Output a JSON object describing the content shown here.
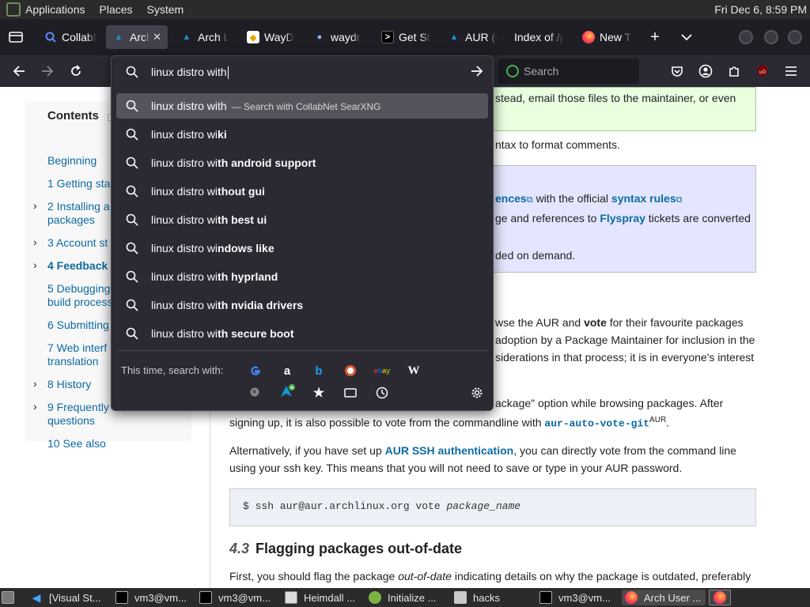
{
  "top_panel": {
    "menus": [
      "Applications",
      "Places",
      "System"
    ],
    "clock": "Fri Dec  6,  8:59 PM"
  },
  "tabs": [
    {
      "label": "CollabNet",
      "icon": "collabnet-icon",
      "active": false
    },
    {
      "label": "Arch User",
      "icon": "arch-icon",
      "active": true
    },
    {
      "label": "Arch Linux",
      "icon": "arch-icon",
      "active": false
    },
    {
      "label": "WayDroid",
      "icon": "waydroid-icon",
      "active": false
    },
    {
      "label": "waydroid",
      "icon": "waydroid-dot-icon",
      "active": false
    },
    {
      "label": "Get Started",
      "icon": "terminal-icon",
      "active": false
    },
    {
      "label": "AUR (en)",
      "icon": "arch-icon",
      "active": false
    },
    {
      "label": "Index of /p",
      "icon": "none",
      "active": false
    },
    {
      "label": "New Tab",
      "icon": "firefox-icon",
      "active": false
    }
  ],
  "search_bar": {
    "placeholder": "Search"
  },
  "urlbar": {
    "value": "linux distro with",
    "suggestions": [
      {
        "typed": "linux distro with",
        "rest": "",
        "sub": "— Search with CollabNet SearXNG",
        "highlight": true
      },
      {
        "typed": "linux distro wi",
        "rest": "ki",
        "sub": "",
        "highlight": false
      },
      {
        "typed": "linux distro wi",
        "rest": "th android support",
        "sub": "",
        "highlight": false
      },
      {
        "typed": "linux distro wi",
        "rest": "thout gui",
        "sub": "",
        "highlight": false
      },
      {
        "typed": "linux distro wi",
        "rest": "th best ui",
        "sub": "",
        "highlight": false
      },
      {
        "typed": "linux distro wi",
        "rest": "ndows like",
        "sub": "",
        "highlight": false
      },
      {
        "typed": "linux distro wi",
        "rest": "th hyprland",
        "sub": "",
        "highlight": false
      },
      {
        "typed": "linux distro wi",
        "rest": "th nvidia drivers",
        "sub": "",
        "highlight": false
      },
      {
        "typed": "linux distro wi",
        "rest": "th secure boot",
        "sub": "",
        "highlight": false
      }
    ],
    "engines_label": "This time, search with:",
    "engines": [
      "google-icon",
      "amazon-icon",
      "bing-icon",
      "duckduckgo-icon",
      "ebay-icon",
      "wikipedia-icon"
    ],
    "engines_row2": [
      "searxng-icon",
      "arch-add-icon",
      "bookmarks-star-icon",
      "tabs-icon",
      "history-icon"
    ]
  },
  "toc": {
    "title": "Contents",
    "items": [
      {
        "text": "Beginning",
        "chev": false,
        "bold": false
      },
      {
        "text": "1  Getting sta",
        "chev": false,
        "bold": false
      },
      {
        "text": "2  Installing a",
        "text2": "packages",
        "chev": true,
        "bold": false
      },
      {
        "text": "3  Account st",
        "chev": true,
        "bold": false
      },
      {
        "text": "4  Feedback",
        "chev": true,
        "bold": true
      },
      {
        "text": "5  Debugging",
        "text2": "build process",
        "chev": false,
        "bold": false
      },
      {
        "text": "6  Submitting",
        "chev": false,
        "bold": false
      },
      {
        "text": "7  Web interf",
        "text2": "translation",
        "chev": false,
        "bold": false
      },
      {
        "text": "8  History",
        "chev": true,
        "bold": false
      },
      {
        "text": "9  Frequently",
        "text2": "questions",
        "chev": true,
        "bold": false
      },
      {
        "text": "10  See also",
        "chev": false,
        "bold": false
      }
    ]
  },
  "content": {
    "green_line": "stead, email those files to the maintainer, or even",
    "syntax_line": "ntax to format comments.",
    "blue_l1_a": "ences",
    "blue_l1_b": " with the official ",
    "blue_l1_c": "syntax rules",
    "blue_l2_a": "ge and references to ",
    "blue_l2_b": "Flyspray",
    "blue_l2_c": " tickets are converted",
    "blue_l3": "ded on demand.",
    "vote_l1_a": "wse the AUR and ",
    "vote_l1_b": "vote",
    "vote_l1_c": " for their favourite packages",
    "vote_l2": " adoption by a Package Maintainer for inclusion in the",
    "vote_l3": "siderations in that process; it is in everyone's interest",
    "pkg_l1": "ackage\" option while browsing packages. After",
    "pkg_l2_a": "signing up, it is also possible to vote from the commandline with ",
    "pkg_l2_b": "aur-auto-vote-git",
    "pkg_l2_c": "AUR",
    "alt_l1_a": "Alternatively, if you have set up ",
    "alt_l1_b": "AUR SSH authentication",
    "alt_l1_c": ", you can directly vote from the command line",
    "alt_l2": "using your ssh key. This means that you will not need to save or type in your AUR password.",
    "code_a": "$ ssh aur@aur.archlinux.org vote ",
    "code_b": "package_name",
    "h3_num": "4.3",
    "h3_text": "Flagging packages out-of-date",
    "last_a": "First, you should flag the package ",
    "last_b": "out-of-date",
    "last_c": " indicating details on why the package is outdated, preferably"
  },
  "taskbar": [
    {
      "label": "[Visual St...",
      "icon": "vscode-icon",
      "active": false
    },
    {
      "label": "vm3@vm...",
      "icon": "terminal-icon",
      "active": false
    },
    {
      "label": "vm3@vm...",
      "icon": "terminal-icon",
      "active": false
    },
    {
      "label": "Heimdall ...",
      "icon": "window-icon",
      "active": false
    },
    {
      "label": "Initialize ...",
      "icon": "app-icon",
      "active": false
    },
    {
      "label": "hacks",
      "icon": "folder-icon",
      "active": false
    },
    {
      "label": "vm3@vm...",
      "icon": "terminal-icon",
      "active": false
    },
    {
      "label": "Arch User ...",
      "icon": "firefox-icon",
      "active": true
    }
  ]
}
